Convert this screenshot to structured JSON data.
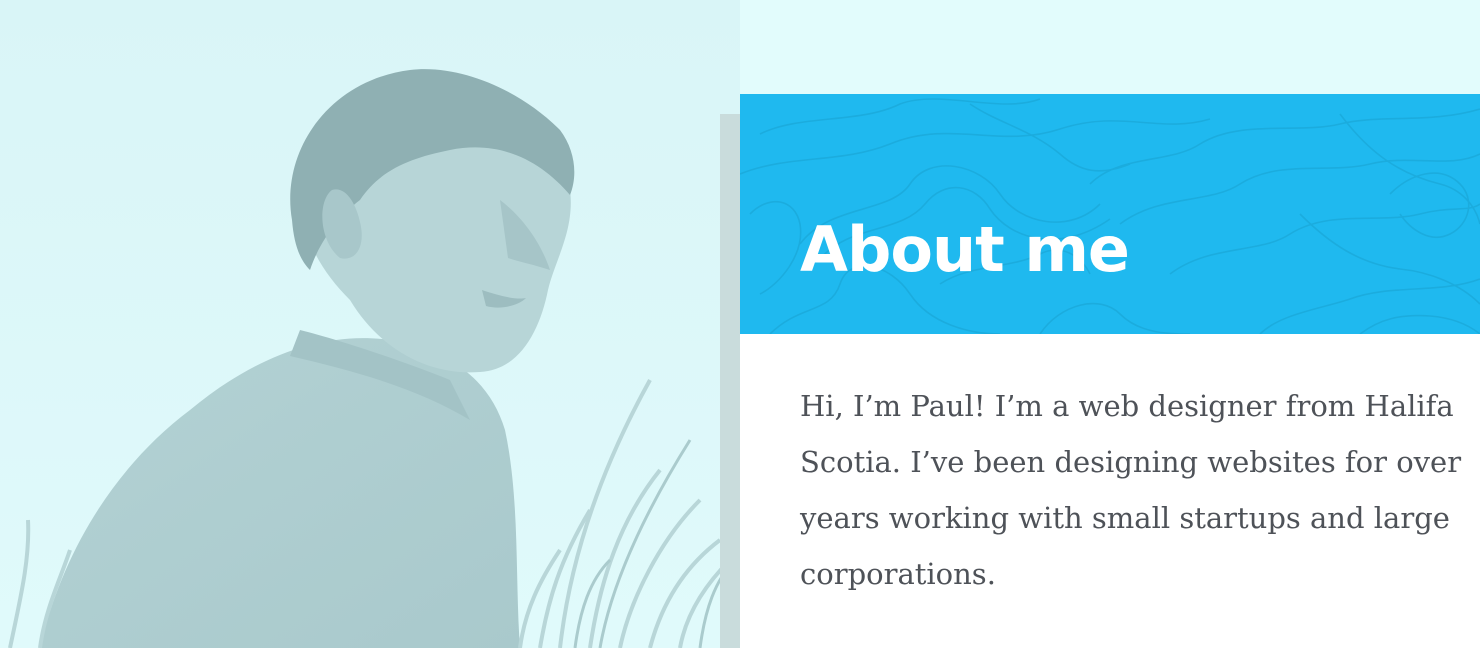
{
  "photo": {
    "alt": "Portrait of Paul",
    "tint": "#c6e6e8"
  },
  "about": {
    "title": "About me",
    "header_color": "#1fb9ef",
    "lines": [
      "Hi, I’m Paul! I’m a web designer from Halifa",
      "Scotia. I’ve been designing websites for over",
      "years working with small startups and large",
      "corporations."
    ]
  },
  "colors": {
    "page_background": "#e2fcfc",
    "body_text": "#4e5258"
  }
}
